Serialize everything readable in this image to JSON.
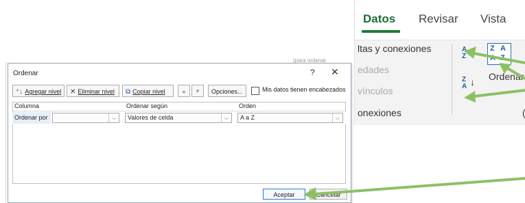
{
  "ribbon": {
    "tabs": [
      {
        "label": "Datos",
        "active": true
      },
      {
        "label": "Revisar",
        "active": false
      },
      {
        "label": "Vista",
        "active": false
      }
    ],
    "group_lines": [
      "ltas y conexiones",
      "edades",
      "vínculos",
      "onexiones"
    ],
    "sort_label": "Ordenar",
    "sort_az_icon": "sort-az-icon",
    "sort_za_icon": "sort-za-icon",
    "group_tail": "("
  },
  "dialog": {
    "title": "Ordenar",
    "help": "?",
    "close": "✕",
    "toolbar": {
      "add_level": "Agregar nivel",
      "delete_level": "Eliminar nivel",
      "copy_level": "Copiar nivel",
      "options": "Opciones...",
      "headers_checkbox": "Mis datos tienen encabezados"
    },
    "columns": {
      "col": "Columna",
      "sort_on": "Ordenar según",
      "order": "Orden"
    },
    "rule": {
      "label": "Ordenar por",
      "column_value": "",
      "sort_on_value": "Valores de celda",
      "order_value": "A a Z"
    },
    "ok": "Aceptar",
    "cancel": "Cancelar"
  },
  "background": {
    "sheet_text": "(para ordenar"
  },
  "colors": {
    "accent_green": "#8dc063",
    "datos_underline": "#1f7a3a"
  }
}
